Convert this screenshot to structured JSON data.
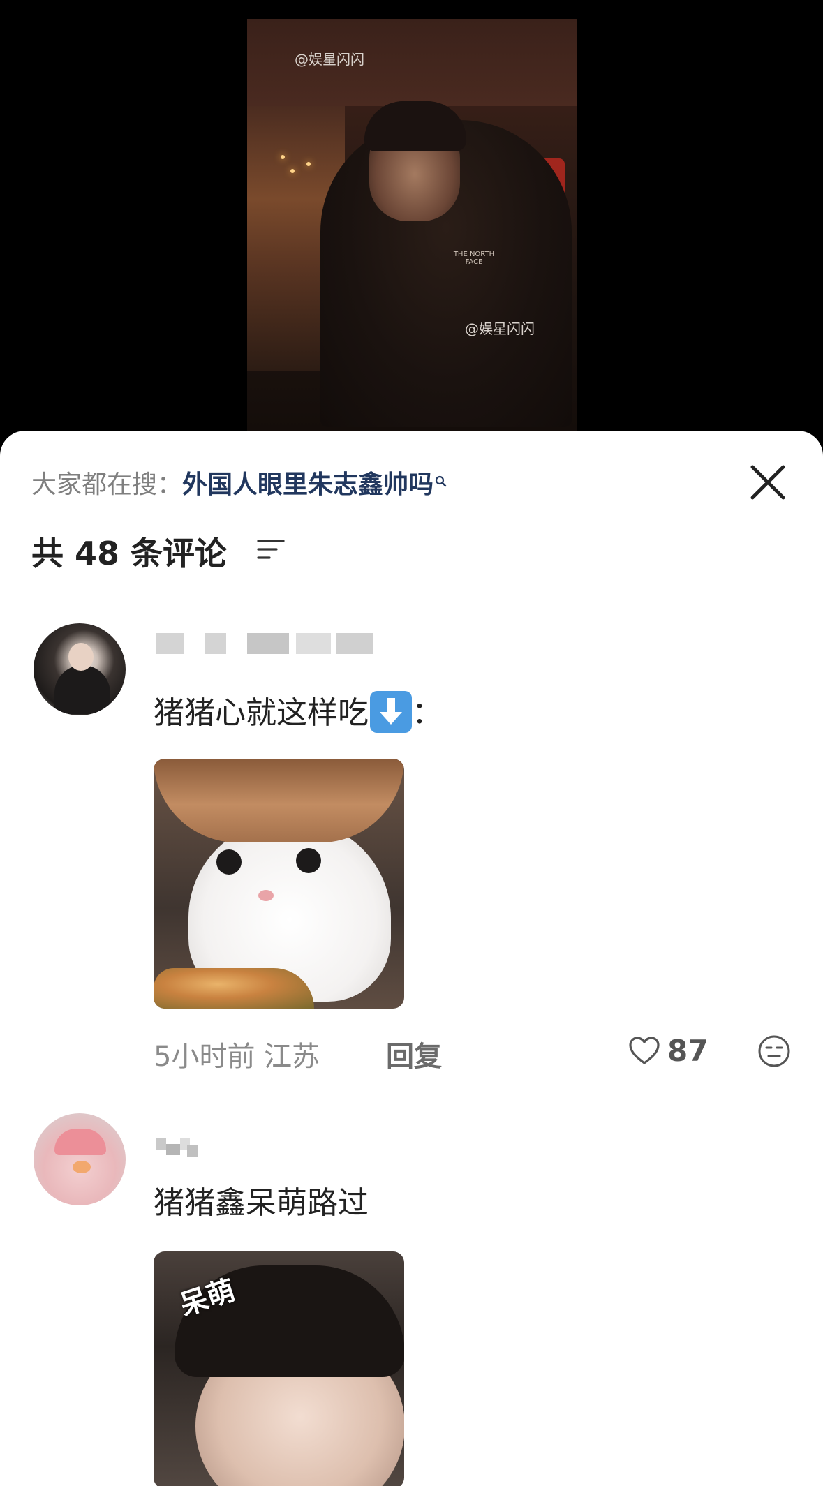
{
  "video": {
    "watermark_top": "@娱星闪闪",
    "watermark_bottom": "@娱星闪闪",
    "jacket_logo": "THE NORTH FACE"
  },
  "sheet": {
    "search_label": "大家都在搜：",
    "search_term": "外国人眼里朱志鑫帅吗",
    "comment_count_title": "共 48 条评论"
  },
  "comments": [
    {
      "text": "猪猪心就这样吃",
      "text_suffix": "：",
      "time_location": "5小时前 江苏",
      "reply_label": "回复",
      "likes": "87"
    },
    {
      "text": "猪猪鑫呆萌路过",
      "sticker_text": "呆萌"
    }
  ],
  "colors": {
    "search_term": "#21375e",
    "background_top": "#000000",
    "sheet_bg": "#ffffff"
  },
  "icons": {
    "search": "magnifier-icon",
    "close": "close-icon",
    "sort": "sort-icon",
    "like": "heart-icon",
    "emoji": "emoji-icon"
  }
}
